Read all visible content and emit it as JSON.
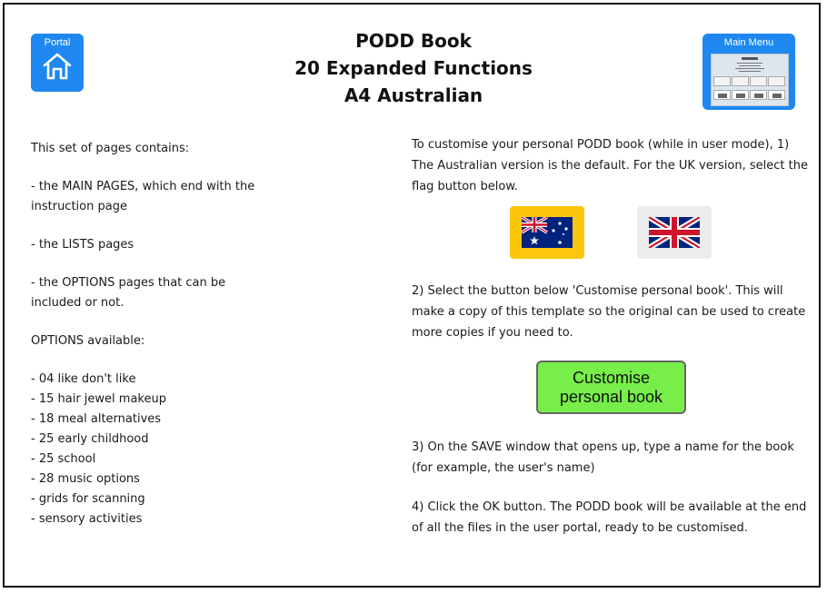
{
  "header": {
    "title_lines": [
      "PODD Book",
      "20 Expanded Functions",
      "A4 Australian"
    ],
    "portal_label": "Portal",
    "main_menu_label": "Main Menu"
  },
  "left": {
    "intro": "This set of pages contains:",
    "main_pages": "- the MAIN PAGES, which end with the instruction page",
    "lists_pages": "- the LISTS pages",
    "options_pages": "- the OPTIONS pages that can be included or not.",
    "options_heading": "OPTIONS available:",
    "options": [
      "- 04 like don't like",
      "- 15 hair jewel makeup",
      "- 18 meal alternatives",
      "- 25 early childhood",
      "- 25 school",
      "- 28 music options",
      "- grids for scanning",
      "- sensory activities"
    ]
  },
  "right": {
    "intro": "To customise your personal PODD book (while in user mode), 1) The Australian version is the default. For the UK version, select the flag button below.",
    "step2": "2) Select the button below 'Customise personal book'. This will make a copy of this template so the original can be used to create more copies if you need to.",
    "customise_label_line1": "Customise",
    "customise_label_line2": "personal book",
    "step3": "3) On the SAVE window that opens up, type a name for the book (for example, the user's name)",
    "step4": "4) Click the OK button. The PODD book will be available at the end of all the files in the user portal, ready to be customised."
  },
  "colors": {
    "nav_blue": "#1e88f0",
    "au_button": "#fcc70a",
    "uk_button": "#ececec",
    "customise_green": "#77ee4a"
  },
  "icons": {
    "portal": "home-icon",
    "au_flag": "australian-flag-icon",
    "uk_flag": "uk-flag-icon"
  }
}
